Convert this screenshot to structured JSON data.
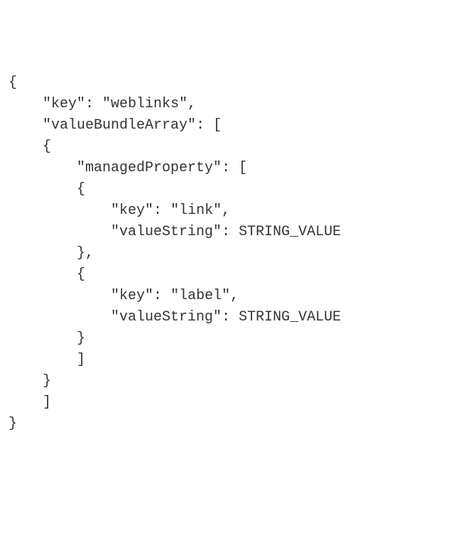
{
  "code": {
    "line1": "{",
    "line2_indent": "    ",
    "line2_key_label": "\"key\"",
    "line2_colon": ": ",
    "line2_key_value": "\"weblinks\"",
    "line2_comma": ",",
    "line3_indent": "    ",
    "line3_vba_label": "\"valueBundleArray\"",
    "line3_colon": ": ",
    "line3_bracket": "[",
    "line4_indent": "    ",
    "line4_brace": "{",
    "line5_indent": "        ",
    "line5_mp_label": "\"managedProperty\"",
    "line5_colon": ": ",
    "line5_bracket": "[",
    "line6_indent": "        ",
    "line6_brace": "{",
    "line7_indent": "            ",
    "line7_key_label": "\"key\"",
    "line7_colon": ": ",
    "line7_key_value": "\"link\"",
    "line7_comma": ",",
    "line8_indent": "            ",
    "line8_vs_label": "\"valueString\"",
    "line8_colon": ": ",
    "line8_vs_value": "STRING_VALUE",
    "line9_indent": "        ",
    "line9_brace": "}",
    "line9_comma": ",",
    "line10_indent": "        ",
    "line10_brace": "{",
    "line11_indent": "            ",
    "line11_key_label": "\"key\"",
    "line11_colon": ": ",
    "line11_key_value": "\"label\"",
    "line11_comma": ",",
    "line12_indent": "            ",
    "line12_vs_label": "\"valueString\"",
    "line12_colon": ": ",
    "line12_vs_value": "STRING_VALUE",
    "line13_indent": "        ",
    "line13_brace": "}",
    "line14_indent": "        ",
    "line14_bracket": "]",
    "line15_indent": "    ",
    "line15_brace": "}",
    "line16_indent": "    ",
    "line16_bracket": "]",
    "line17": "}"
  }
}
